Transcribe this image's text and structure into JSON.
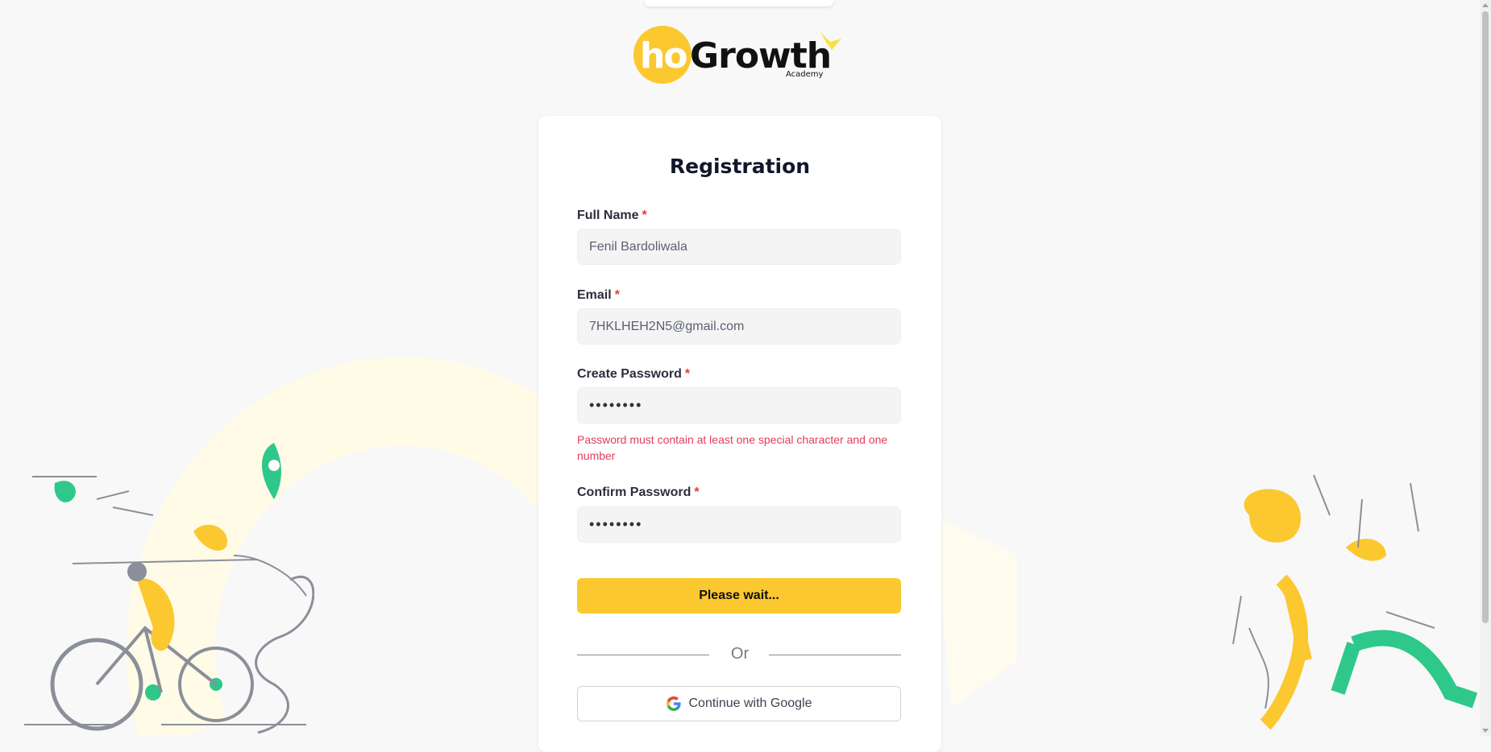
{
  "logo": {
    "ho": "ho",
    "growth": "Growth",
    "academy": "Academy"
  },
  "form": {
    "title": "Registration",
    "full_name": {
      "label": "Full Name",
      "required": "*",
      "value": "Fenil Bardoliwala"
    },
    "email": {
      "label": "Email",
      "required": "*",
      "value": "7HKLHEH2N5@gmail.com"
    },
    "create_password": {
      "label": "Create Password",
      "required": "*",
      "value": "••••••••",
      "error": "Password must contain at least one special character and one number"
    },
    "confirm_password": {
      "label": "Confirm Password",
      "required": "*",
      "value": "••••••••"
    },
    "submit_label": "Please wait...",
    "divider_text": "Or",
    "google_label": "Continue with Google"
  },
  "colors": {
    "accent": "#fbc830",
    "error": "#e23d5a",
    "green": "#2dc88a"
  },
  "icons": {
    "google": "google-icon",
    "location_pin": "location-pin-icon"
  }
}
